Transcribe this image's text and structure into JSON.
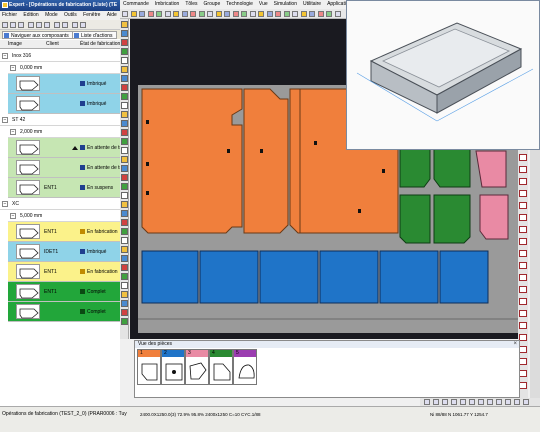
{
  "left_window": {
    "title": "Expert - [Opérations de fabrication (Liste) (TE",
    "menu": [
      "Fichier",
      "Edition",
      "Mode",
      "Outils",
      "Fenêtre",
      "Aide"
    ],
    "tabs": [
      "Naviguer aux composants",
      "Liste d'actions"
    ],
    "columns": [
      "Image",
      "Client",
      "État de fabrication"
    ],
    "groups": [
      {
        "label": "Inox 316",
        "subs": [
          {
            "label": "0,000 mm",
            "rows": [
              {
                "client": "",
                "status": "Imbriqué",
                "color": "#8fd3e8"
              },
              {
                "client": "",
                "status": "Imbriqué",
                "color": "#8fd3e8"
              }
            ]
          }
        ]
      },
      {
        "label": "ST 42",
        "subs": [
          {
            "label": "2,000 mm",
            "rows": [
              {
                "client": "",
                "status": "En attente de tr",
                "color": "#c6e6b3"
              },
              {
                "client": "",
                "status": "En attente de tr",
                "color": "#c6e6b3"
              },
              {
                "client": "ENT1",
                "status": "En suspens",
                "color": "#c6e6b3"
              }
            ]
          }
        ]
      },
      {
        "label": "XC",
        "subs": [
          {
            "label": "5,000 mm",
            "rows": [
              {
                "client": "ENT1",
                "status": "En fabrication",
                "color": "#fbf28a"
              },
              {
                "client": "IDET1",
                "status": "Imbriqué",
                "color": "#8fd3e8"
              },
              {
                "client": "ENT1",
                "status": "En fabrication",
                "color": "#fbf28a"
              },
              {
                "client": "ENT1",
                "status": "Complet",
                "color": "#22a63a"
              },
              {
                "client": "",
                "status": "Complet",
                "color": "#22a63a"
              }
            ]
          }
        ]
      }
    ]
  },
  "main_window": {
    "menu": [
      "Commande",
      "Imbrication",
      "Tôles",
      "Groupe",
      "Technologie",
      "Vue",
      "Simulation",
      "Utilitaire",
      "Applications"
    ],
    "parts_panel_title": "Vue des pièces",
    "parts": [
      {
        "num": "1",
        "color": "#f07f3c"
      },
      {
        "num": "2",
        "color": "#1f74c8"
      },
      {
        "num": "3",
        "color": "#e98aa4"
      },
      {
        "num": "4",
        "color": "#2a8a32"
      },
      {
        "num": "5",
        "color": "#9b3db0"
      }
    ]
  },
  "status_bar": {
    "left": "Opérations de fabrication (TEST_2_0) (PRAR0006 : Tuy",
    "mid": "2400.0X1250.0(3) 72.9% 95.8% 2400x1250 C=10 CYC.1/88",
    "right": "Ni 88/88   N 1061.77   Y 1254.7"
  },
  "colors": {
    "orange": "#f07f3c",
    "blue": "#1f74c8",
    "green": "#2a8a32",
    "pink": "#e98aa4",
    "sheet": "#9a9a9a",
    "cyan": "#8fd3e8",
    "lightgreen": "#c6e6b3",
    "yellow": "#fbf28a",
    "darkgreen": "#22a63a"
  }
}
